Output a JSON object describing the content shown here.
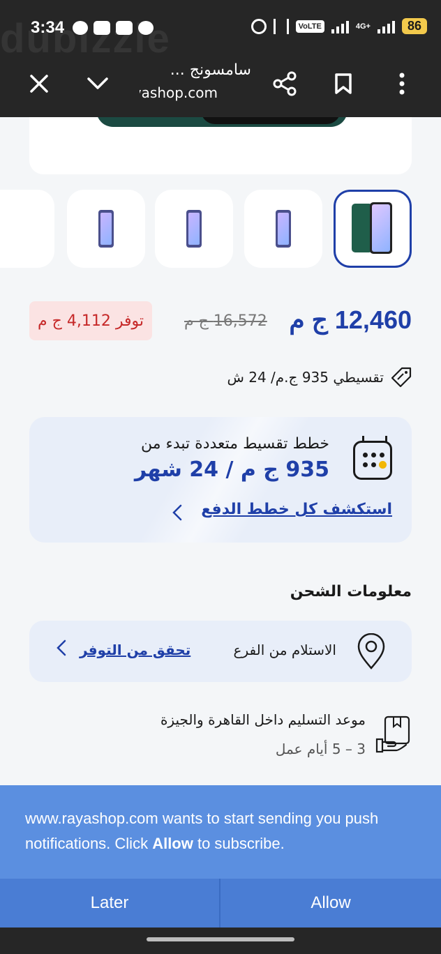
{
  "status_bar": {
    "time": "3:34",
    "volte": "VoLTE",
    "network": "4G+",
    "battery": "86"
  },
  "browser": {
    "title": "سامسونج ...",
    "url": "rayashop.com"
  },
  "product": {
    "price": "12,460 ج م",
    "old_price": "16,572 ج م",
    "savings": "توفر 4,112 ج م",
    "installment_line": "تقسيطي 935 ج.م/ 24 ش"
  },
  "plans": {
    "subtitle": "خطط تقسيط متعددة تبدء من",
    "amount": "935 ج م / 24 شهر",
    "link": "استكشف كل خطط الدفع"
  },
  "shipping": {
    "title": "معلومات الشحن",
    "pickup_label": "الاستلام من الفرع",
    "pickup_link": "تحقق من التوفر",
    "delivery_title": "موعد التسليم داخل القاهرة والجيزة",
    "delivery_days": "3 – 5 أيام عمل"
  },
  "notification": {
    "message_start": "www.rayashop.com wants to start sending you push notifications. Click ",
    "message_bold": "Allow",
    "message_end": " to subscribe.",
    "later_label": "Later",
    "allow_label": "Allow"
  },
  "colors": {
    "primary": "#1f3fa8",
    "savings_bg": "#fbe3e3",
    "savings_text": "#c62828",
    "banner": "#5b8fe0"
  }
}
